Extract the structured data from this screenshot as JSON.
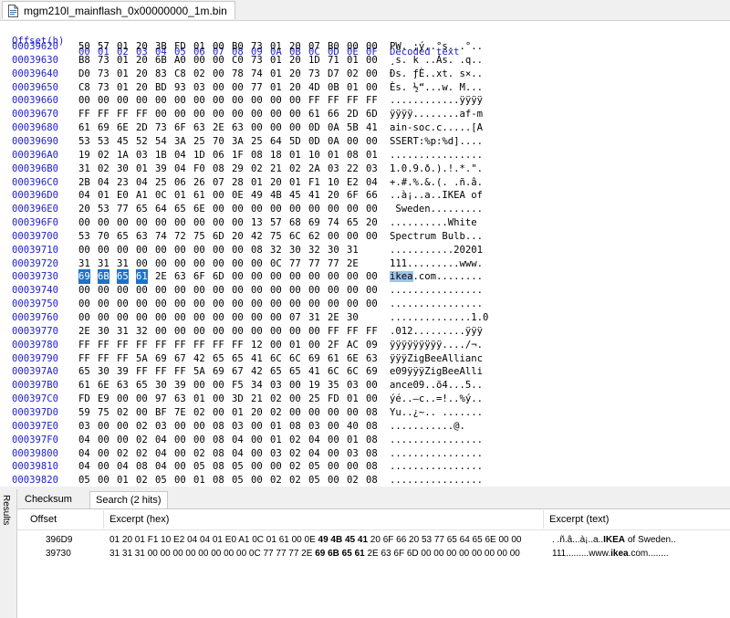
{
  "tab": {
    "filename": "mgm210l_mainflash_0x00000000_1m.bin"
  },
  "header": {
    "offset_label": "Offset(h)",
    "columns": [
      "00",
      "01",
      "02",
      "03",
      "04",
      "05",
      "06",
      "07",
      "08",
      "09",
      "0A",
      "0B",
      "0C",
      "0D",
      "0E",
      "0F"
    ],
    "decoded_label": "Decoded text"
  },
  "rows": [
    {
      "offset": "00039620",
      "hex": [
        "50",
        "57",
        "01",
        "20",
        "3B",
        "FD",
        "01",
        "00",
        "B0",
        "73",
        "01",
        "20",
        "07",
        "B0",
        "00",
        "00"
      ],
      "text": "PW. ;ý..°s. .°.."
    },
    {
      "offset": "00039630",
      "hex": [
        "B8",
        "73",
        "01",
        "20",
        "6B",
        "A0",
        "00",
        "00",
        "C0",
        "73",
        "01",
        "20",
        "1D",
        "71",
        "01",
        "00"
      ],
      "text": "¸s. k ..Às. .q.."
    },
    {
      "offset": "00039640",
      "hex": [
        "D0",
        "73",
        "01",
        "20",
        "83",
        "C8",
        "02",
        "00",
        "78",
        "74",
        "01",
        "20",
        "73",
        "D7",
        "02",
        "00"
      ],
      "text": "Ðs. ƒÈ..xt. s×.."
    },
    {
      "offset": "00039650",
      "hex": [
        "C8",
        "73",
        "01",
        "20",
        "BD",
        "93",
        "03",
        "00",
        "00",
        "77",
        "01",
        "20",
        "4D",
        "0B",
        "01",
        "00"
      ],
      "text": "Ès. ½“...w. M..."
    },
    {
      "offset": "00039660",
      "hex": [
        "00",
        "00",
        "00",
        "00",
        "00",
        "00",
        "00",
        "00",
        "00",
        "00",
        "00",
        "00",
        "FF",
        "FF",
        "FF",
        "FF"
      ],
      "text": "............ÿÿÿÿ"
    },
    {
      "offset": "00039670",
      "hex": [
        "FF",
        "FF",
        "FF",
        "FF",
        "00",
        "00",
        "00",
        "00",
        "00",
        "00",
        "00",
        "00",
        "61",
        "66",
        "2D",
        "6D"
      ],
      "text": "ÿÿÿÿ........af-m"
    },
    {
      "offset": "00039680",
      "hex": [
        "61",
        "69",
        "6E",
        "2D",
        "73",
        "6F",
        "63",
        "2E",
        "63",
        "00",
        "00",
        "00",
        "0D",
        "0A",
        "5B",
        "41"
      ],
      "text": "ain-soc.c.....[A"
    },
    {
      "offset": "00039690",
      "hex": [
        "53",
        "53",
        "45",
        "52",
        "54",
        "3A",
        "25",
        "70",
        "3A",
        "25",
        "64",
        "5D",
        "0D",
        "0A",
        "00",
        "00"
      ],
      "text": "SSERT:%p:%d]...."
    },
    {
      "offset": "000396A0",
      "hex": [
        "19",
        "02",
        "1A",
        "03",
        "1B",
        "04",
        "1D",
        "06",
        "1F",
        "08",
        "18",
        "01",
        "10",
        "01",
        "08",
        "01"
      ],
      "text": "................"
    },
    {
      "offset": "000396B0",
      "hex": [
        "31",
        "02",
        "30",
        "01",
        "39",
        "04",
        "F0",
        "08",
        "29",
        "02",
        "21",
        "02",
        "2A",
        "03",
        "22",
        "03"
      ],
      "text": "1.0.9.ð.).!.*.\"."
    },
    {
      "offset": "000396C0",
      "hex": [
        "2B",
        "04",
        "23",
        "04",
        "25",
        "06",
        "26",
        "07",
        "28",
        "01",
        "20",
        "01",
        "F1",
        "10",
        "E2",
        "04"
      ],
      "text": "+.#.%.&.(. .ñ.â."
    },
    {
      "offset": "000396D0",
      "hex": [
        "04",
        "01",
        "E0",
        "A1",
        "0C",
        "01",
        "61",
        "00",
        "0E",
        "49",
        "4B",
        "45",
        "41",
        "20",
        "6F",
        "66"
      ],
      "text": "..à¡..a..IKEA of"
    },
    {
      "offset": "000396E0",
      "hex": [
        "20",
        "53",
        "77",
        "65",
        "64",
        "65",
        "6E",
        "00",
        "00",
        "00",
        "00",
        "00",
        "00",
        "00",
        "00",
        "00"
      ],
      "text": " Sweden........."
    },
    {
      "offset": "000396F0",
      "hex": [
        "00",
        "00",
        "00",
        "00",
        "00",
        "00",
        "00",
        "00",
        "00",
        "13",
        "57",
        "68",
        "69",
        "74",
        "65",
        "20"
      ],
      "text": "..........White "
    },
    {
      "offset": "00039700",
      "hex": [
        "53",
        "70",
        "65",
        "63",
        "74",
        "72",
        "75",
        "6D",
        "20",
        "42",
        "75",
        "6C",
        "62",
        "00",
        "00",
        "00"
      ],
      "text": "Spectrum Bulb..."
    },
    {
      "offset": "00039710",
      "hex": [
        "00",
        "00",
        "00",
        "00",
        "00",
        "00",
        "00",
        "00",
        "00",
        "08",
        "32",
        "30",
        "32",
        "30",
        "31"
      ],
      "text": "...........20201"
    },
    {
      "offset": "00039720",
      "hex": [
        "31",
        "31",
        "31",
        "00",
        "00",
        "00",
        "00",
        "00",
        "00",
        "00",
        "0C",
        "77",
        "77",
        "77",
        "2E"
      ],
      "text": "111.........www."
    },
    {
      "offset": "00039730",
      "hex": [
        "69",
        "6B",
        "65",
        "61",
        "2E",
        "63",
        "6F",
        "6D",
        "00",
        "00",
        "00",
        "00",
        "00",
        "00",
        "00",
        "00"
      ],
      "text": "ikea.com........",
      "sel": [
        0,
        1,
        2,
        3
      ],
      "text_hl_start": 0,
      "text_hl_len": 4
    },
    {
      "offset": "00039740",
      "hex": [
        "00",
        "00",
        "00",
        "00",
        "00",
        "00",
        "00",
        "00",
        "00",
        "00",
        "00",
        "00",
        "00",
        "00",
        "00",
        "00"
      ],
      "text": "................"
    },
    {
      "offset": "00039750",
      "hex": [
        "00",
        "00",
        "00",
        "00",
        "00",
        "00",
        "00",
        "00",
        "00",
        "00",
        "00",
        "00",
        "00",
        "00",
        "00",
        "00"
      ],
      "text": "................"
    },
    {
      "offset": "00039760",
      "hex": [
        "00",
        "00",
        "00",
        "00",
        "00",
        "00",
        "00",
        "00",
        "00",
        "00",
        "00",
        "07",
        "31",
        "2E",
        "30"
      ],
      "text": "..............1.0"
    },
    {
      "offset": "00039770",
      "hex": [
        "2E",
        "30",
        "31",
        "32",
        "00",
        "00",
        "00",
        "00",
        "00",
        "00",
        "00",
        "00",
        "00",
        "FF",
        "FF",
        "FF"
      ],
      "text": ".012.........ÿÿÿ"
    },
    {
      "offset": "00039780",
      "hex": [
        "FF",
        "FF",
        "FF",
        "FF",
        "FF",
        "FF",
        "FF",
        "FF",
        "FF",
        "12",
        "00",
        "01",
        "00",
        "2F",
        "AC",
        "09"
      ],
      "text": "ÿÿÿÿÿÿÿÿÿ..../¬."
    },
    {
      "offset": "00039790",
      "hex": [
        "FF",
        "FF",
        "FF",
        "5A",
        "69",
        "67",
        "42",
        "65",
        "65",
        "41",
        "6C",
        "6C",
        "69",
        "61",
        "6E",
        "63"
      ],
      "text": "ÿÿÿZigBeeAllianc"
    },
    {
      "offset": "000397A0",
      "hex": [
        "65",
        "30",
        "39",
        "FF",
        "FF",
        "FF",
        "5A",
        "69",
        "67",
        "42",
        "65",
        "65",
        "41",
        "6C",
        "6C",
        "69"
      ],
      "text": "e09ÿÿÿZigBeeAlli"
    },
    {
      "offset": "000397B0",
      "hex": [
        "61",
        "6E",
        "63",
        "65",
        "30",
        "39",
        "00",
        "00",
        "F5",
        "34",
        "03",
        "00",
        "19",
        "35",
        "03",
        "00"
      ],
      "text": "ance09..õ4...5.."
    },
    {
      "offset": "000397C0",
      "hex": [
        "FD",
        "E9",
        "00",
        "00",
        "97",
        "63",
        "01",
        "00",
        "3D",
        "21",
        "02",
        "00",
        "25",
        "FD",
        "01",
        "00"
      ],
      "text": "ýé..—c..=!..%ý.."
    },
    {
      "offset": "000397D0",
      "hex": [
        "59",
        "75",
        "02",
        "00",
        "BF",
        "7E",
        "02",
        "00",
        "01",
        "20",
        "02",
        "00",
        "00",
        "00",
        "00",
        "08"
      ],
      "text": "Yu..¿~.. ......."
    },
    {
      "offset": "000397E0",
      "hex": [
        "03",
        "00",
        "00",
        "02",
        "03",
        "00",
        "00",
        "08",
        "03",
        "00",
        "01",
        "08",
        "03",
        "00",
        "40",
        "08"
      ],
      "text": "...........@."
    },
    {
      "offset": "000397F0",
      "hex": [
        "04",
        "00",
        "00",
        "02",
        "04",
        "00",
        "00",
        "08",
        "04",
        "00",
        "01",
        "02",
        "04",
        "00",
        "01",
        "08"
      ],
      "text": "................"
    },
    {
      "offset": "00039800",
      "hex": [
        "04",
        "00",
        "02",
        "02",
        "04",
        "00",
        "02",
        "08",
        "04",
        "00",
        "03",
        "02",
        "04",
        "00",
        "03",
        "08"
      ],
      "text": "................"
    },
    {
      "offset": "00039810",
      "hex": [
        "04",
        "00",
        "04",
        "08",
        "04",
        "00",
        "05",
        "08",
        "05",
        "00",
        "00",
        "02",
        "05",
        "00",
        "00",
        "08"
      ],
      "text": "................"
    },
    {
      "offset": "00039820",
      "hex": [
        "05",
        "00",
        "01",
        "02",
        "05",
        "00",
        "01",
        "08",
        "05",
        "00",
        "02",
        "02",
        "05",
        "00",
        "02",
        "08"
      ],
      "text": "................"
    },
    {
      "offset": "00039830",
      "hex": [
        "05",
        "00",
        "03",
        "02",
        "05",
        "00",
        "03",
        "08",
        "05",
        "00",
        "04",
        "02",
        "05",
        "00",
        "04",
        "08"
      ],
      "text": "................"
    }
  ],
  "results": {
    "side_label": "Results",
    "tabs": [
      "Checksum",
      "Search (2 hits)"
    ],
    "columns": [
      "Offset",
      "Excerpt (hex)",
      "Excerpt (text)"
    ],
    "hits": [
      {
        "offset": "396D9",
        "hex_pre": "01 20 01 F1 10 E2 04 04 01 E0 A1 0C 01 61 00 0E ",
        "hex_match": "49 4B 45 41",
        "hex_post": " 20 6F 66 20 53 77 65 64 65 6E 00 00",
        "text_pre": ". .ñ.â...à¡..a..",
        "text_match": "IKEA",
        "text_post": " of Sweden.."
      },
      {
        "offset": "39730",
        "hex_pre": "31 31 31 00 00 00 00 00 00 00 00 0C 77 77 77 2E ",
        "hex_match": "69 6B 65 61",
        "hex_post": " 2E 63 6F 6D 00 00 00 00 00 00 00 00",
        "text_pre": "111.........www.",
        "text_match": "ikea",
        "text_post": ".com........"
      }
    ]
  }
}
